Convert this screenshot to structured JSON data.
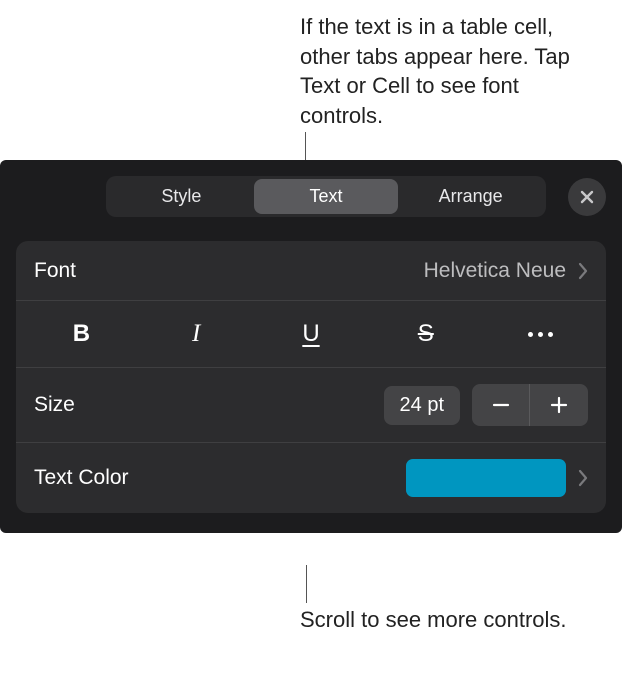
{
  "callouts": {
    "top": "If the text is in a table cell, other tabs appear here. Tap Text or Cell to see font controls.",
    "bottom": "Scroll to see more controls."
  },
  "tabs": {
    "style": "Style",
    "text": "Text",
    "arrange": "Arrange"
  },
  "font": {
    "label": "Font",
    "value": "Helvetica Neue"
  },
  "style_buttons": {
    "bold": "B",
    "italic": "I",
    "underline": "U",
    "strike": "S"
  },
  "size": {
    "label": "Size",
    "value": "24 pt"
  },
  "text_color": {
    "label": "Text Color",
    "swatch": "#0096c0"
  }
}
